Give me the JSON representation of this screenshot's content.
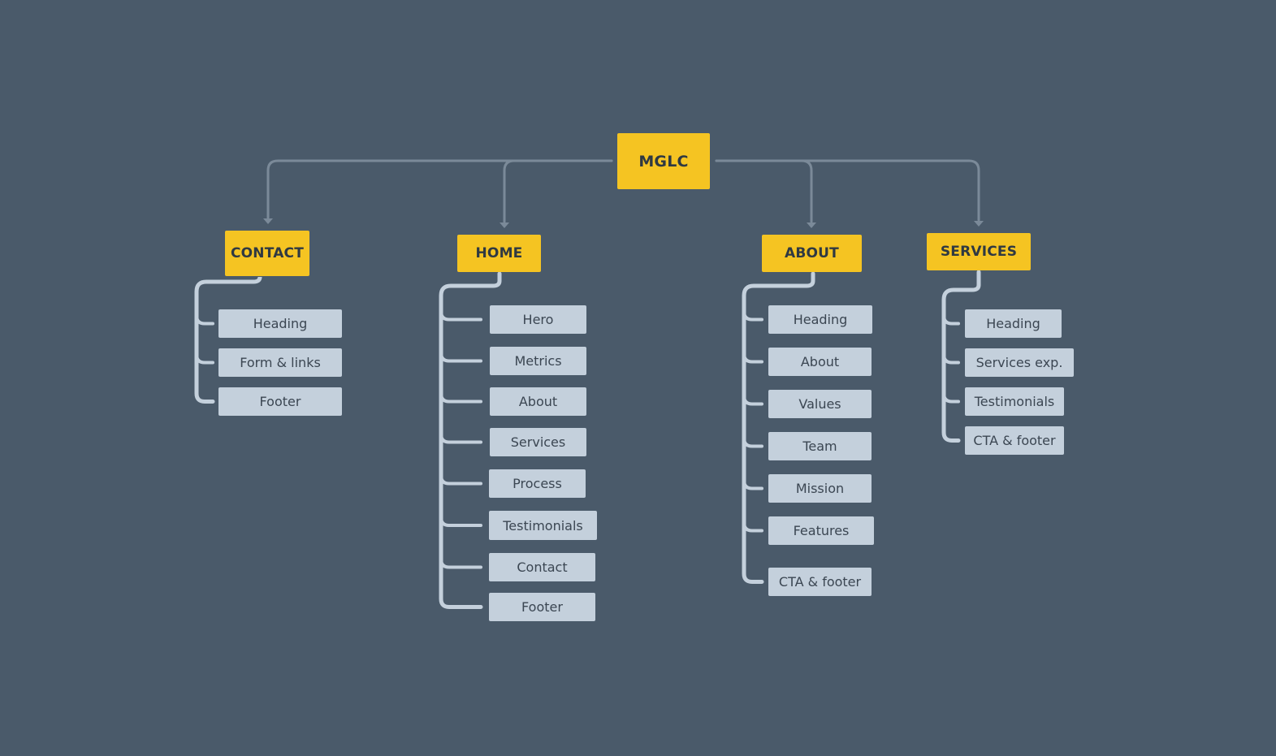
{
  "colors": {
    "background": "#4a5a6a",
    "section": "#f5c422",
    "page_block": "#c4d0dc",
    "connector": "#7b8a99"
  },
  "root": {
    "label": "MGLC"
  },
  "sections": [
    {
      "label": "CONTACT",
      "children": [
        "Heading",
        "Form & links",
        "Footer"
      ]
    },
    {
      "label": "HOME",
      "children": [
        "Hero",
        "Metrics",
        "About",
        "Services",
        "Process",
        "Testimonials",
        "Contact",
        "Footer"
      ]
    },
    {
      "label": "ABOUT",
      "children": [
        "Heading",
        "About",
        "Values",
        "Team",
        "Mission",
        "Features",
        "CTA & footer"
      ]
    },
    {
      "label": "SERVICES",
      "children": [
        "Heading",
        "Services exp.",
        "Testimonials",
        "CTA & footer"
      ]
    }
  ]
}
